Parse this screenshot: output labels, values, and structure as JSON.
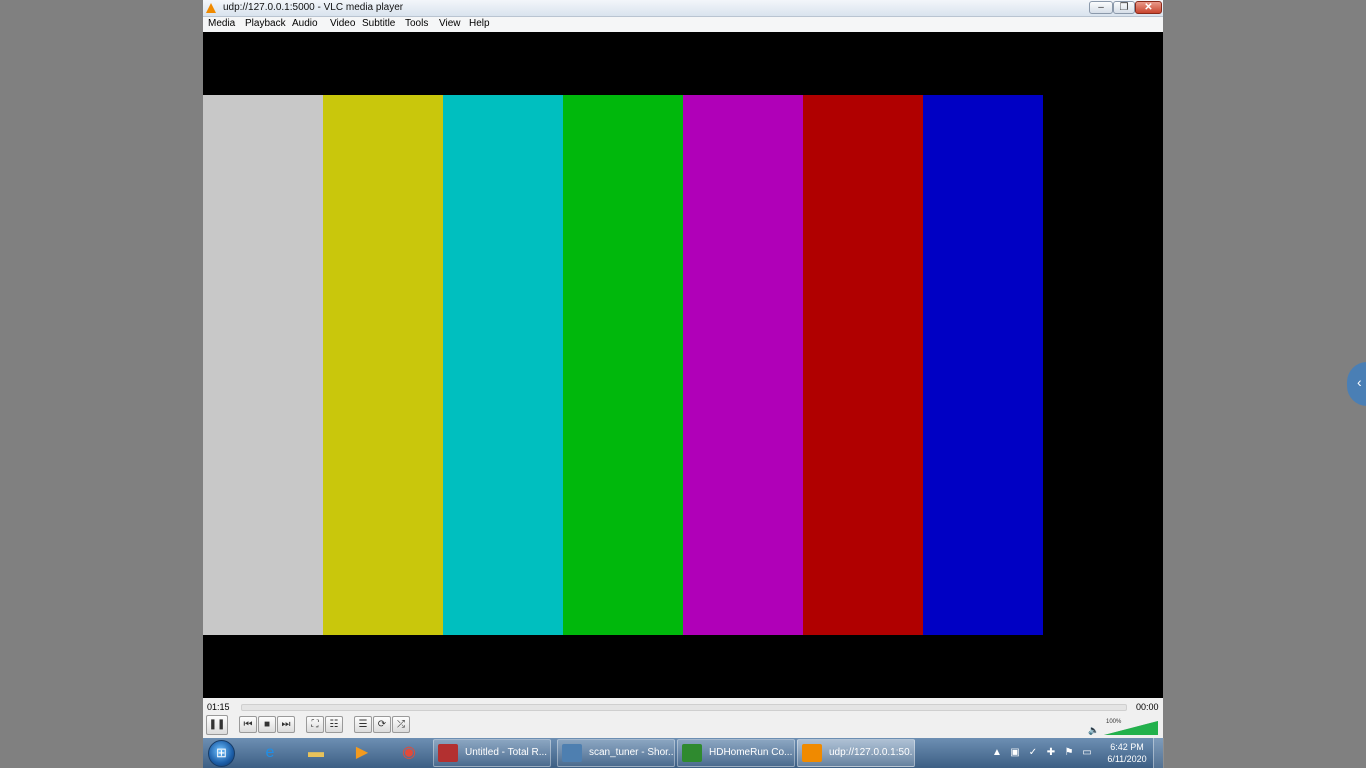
{
  "window": {
    "title": "udp://127.0.0.1:5000 - VLC media player",
    "buttons": {
      "minimize": "–",
      "maximize": "❐",
      "close": "✕"
    }
  },
  "menu": [
    "Media",
    "Playback",
    "Audio",
    "Video",
    "Subtitle",
    "Tools",
    "View",
    "Help"
  ],
  "video": {
    "color_bars": [
      "#c8c8c8",
      "#c9c70c",
      "#00bfbf",
      "#00b80c",
      "#b000b8",
      "#b00000",
      "#0000c4"
    ]
  },
  "controls": {
    "elapsed": "01:15",
    "remaining": "00:00",
    "volume_percent": "100%",
    "volume_level": 1.0,
    "buttons": {
      "pause": "❚❚",
      "previous": "⏮",
      "stop": "■",
      "next": "⏭",
      "fullscreen": "⛶",
      "extended": "☷",
      "playlist": "☰",
      "loop": "⟳",
      "shuffle": "⤮"
    },
    "mute_icon": "🔈"
  },
  "taskbar": {
    "start_glyph": "⊞",
    "pinned": [
      {
        "icon": "internet-explorer-icon",
        "glyph": "e",
        "color": "#1f8ee6"
      },
      {
        "icon": "folder-icon",
        "glyph": "▬",
        "color": "#e8c25a"
      },
      {
        "icon": "media-player-icon",
        "glyph": "▶",
        "color": "#f39a1e"
      },
      {
        "icon": "chrome-icon",
        "glyph": "◉",
        "color": "#e04b3a"
      }
    ],
    "tasks": [
      {
        "label": "Untitled - Total R...",
        "icon_color": "#b33030"
      },
      {
        "label": "scan_tuner - Shor...",
        "icon_color": "#4e7fb0"
      },
      {
        "label": "HDHomeRun Co...",
        "icon_color": "#2f8a2f"
      },
      {
        "label": "udp://127.0.0.1:50...",
        "icon_color": "#f08a00"
      }
    ],
    "tray_icons": [
      "vlc-tray-icon",
      "monitor-icon",
      "security-icon",
      "network-icon",
      "flag-icon",
      "display-icon",
      "volume-icon"
    ],
    "tray_glyphs": [
      "▲",
      "▣",
      "✓",
      "✚",
      "⚑",
      "▭",
      "🔈"
    ],
    "clock_time": "6:42 PM",
    "clock_date": "6/11/2020"
  },
  "side_tab_glyph": "‹"
}
